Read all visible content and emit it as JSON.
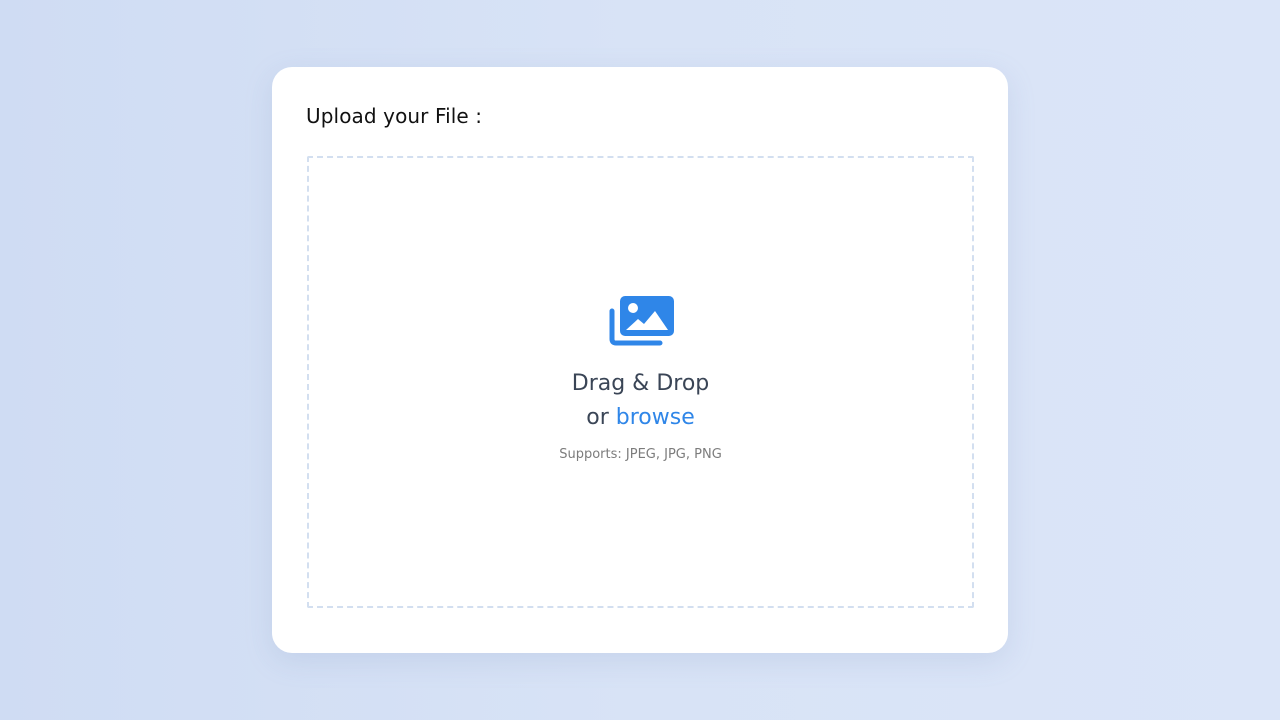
{
  "upload": {
    "title": "Upload your File :",
    "drag_text": "Drag & Drop",
    "or_text": "or ",
    "browse_text": "browse",
    "supports_text": "Supports: JPEG, JPG, PNG",
    "icon": "images-icon",
    "accent_color": "#2f86e8"
  }
}
